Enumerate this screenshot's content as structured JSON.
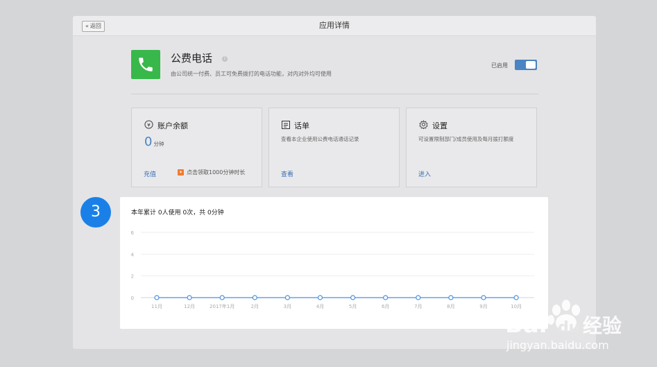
{
  "window": {
    "title": "应用详情",
    "back_label": "返回"
  },
  "app": {
    "name": "公费电话",
    "description": "由公司统一付费、员工可免费拨打的电话功能，对内对外均可使用",
    "status_label": "已启用",
    "enabled": true,
    "icon": "phone-icon",
    "icon_color": "#38b84b"
  },
  "cards": [
    {
      "title": "账户余额",
      "icon": "yen-coin-icon",
      "balance_value": "0",
      "balance_unit": "分钟",
      "link": "充值",
      "promo": "点击领取1000分钟时长"
    },
    {
      "title": "话单",
      "icon": "document-list-icon",
      "description": "查看本企业使用公费电话通话记录",
      "link": "查看"
    },
    {
      "title": "设置",
      "icon": "gear-icon",
      "description": "可设置限制部门/成员使用及每月拨打额度",
      "link": "进入"
    }
  ],
  "step_badge": "3",
  "usage": {
    "title": "本年累计 0人使用 0次，共 0分钟"
  },
  "chart_data": {
    "type": "line",
    "categories": [
      "11月",
      "12月",
      "2017年1月",
      "2月",
      "3月",
      "4月",
      "5月",
      "6月",
      "7月",
      "8月",
      "9月",
      "10月"
    ],
    "values": [
      0,
      0,
      0,
      0,
      0,
      0,
      0,
      0,
      0,
      0,
      0,
      0
    ],
    "title": "",
    "xlabel": "",
    "ylabel": "",
    "ylim": [
      0,
      6
    ],
    "yticks": [
      0,
      2,
      4,
      6
    ],
    "grid": true,
    "line_color": "#4a90d9"
  },
  "watermark": {
    "brand_latin_1": "Bai",
    "brand_latin_2": "du",
    "brand_cn": "经验",
    "url": "jingyan.baidu.com"
  },
  "colors": {
    "accent": "#4a84c2",
    "badge": "#1a80e8",
    "promo": "#f27a31"
  }
}
